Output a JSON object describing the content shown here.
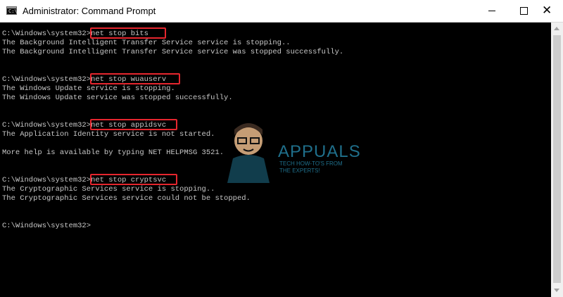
{
  "window": {
    "title": "Administrator: Command Prompt",
    "icon": "cmd-icon"
  },
  "console_lines": [
    "C:\\Windows\\system32>net stop bits",
    "The Background Intelligent Transfer Service service is stopping..",
    "The Background Intelligent Transfer Service service was stopped successfully.",
    "C:\\Windows\\system32>net stop wuauserv",
    "The Windows Update service is stopping.",
    "The Windows Update service was stopped successfully.",
    "C:\\Windows\\system32>net stop appidsvc",
    "The Application Identity service is not started.",
    "More help is available by typing NET HELPMSG 3521.",
    "C:\\Windows\\system32>net stop cryptsvc",
    "The Cryptographic Services service is stopping..",
    "The Cryptographic Services service could not be stopped.",
    "C:\\Windows\\system32>"
  ],
  "highlighted_commands": [
    "net stop bits",
    "net stop wuauserv",
    "net stop appidsvc",
    "net stop cryptsvc"
  ],
  "watermark": {
    "brand": "APPUALS",
    "tagline_1": "TECH HOW-TO'S FROM",
    "tagline_2": "THE EXPERTS!"
  },
  "colors": {
    "console_bg": "#000000",
    "console_text": "#c8c8c8",
    "highlight": "#e5262e",
    "titlebar_bg": "#ffffff"
  }
}
